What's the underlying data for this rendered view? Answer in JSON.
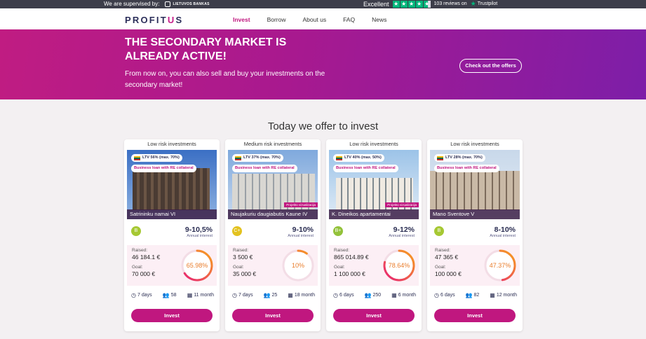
{
  "topbar": {
    "supervised": "We are supervised by:",
    "bank": "LIETUVOS BANKAS",
    "rating_word": "Excellent",
    "reviews": "103 reviews on",
    "trustpilot": "Trustpilot"
  },
  "nav": {
    "brand_a": "PROFIT",
    "brand_b": "U",
    "brand_c": "S",
    "items": [
      "Invest",
      "Borrow",
      "About us",
      "FAQ",
      "News"
    ]
  },
  "hero": {
    "title": "THE SECONDARY MARKET IS ALREADY ACTIVE!",
    "text": "From now on, you can also sell and buy your investments on the secondary market!",
    "cta": "Check out the offers"
  },
  "section_title": "Today we offer to invest",
  "labels": {
    "annual_interest": "Annual interest",
    "raised": "Raised:",
    "goal": "Goal:",
    "invest": "Invest",
    "business_loan": "Business loan with RE collateral",
    "project_vis": "Projekto vizualizacija"
  },
  "cards": [
    {
      "risk": "Low risk investments",
      "ltv": "LTV 56% (max. 70%)",
      "name": "Satrininku namai VI",
      "grade": "B",
      "grade_color": "#a6c833",
      "rate": "9-10,5%",
      "raised": "46 184.1 €",
      "goal": "70 000 €",
      "pct": "65.98%",
      "progress": 0.6598,
      "days": "7 days",
      "investors": "58",
      "term": "11 month"
    },
    {
      "risk": "Medium risk investments",
      "ltv": "LTV 37% (max. 70%)",
      "name": "Naujakuriu daugiabutis Kaune IV",
      "grade": "C+",
      "grade_color": "#e3c21f",
      "rate": "9-10%",
      "raised": "3 500 €",
      "goal": "35 000 €",
      "pct": "10%",
      "progress": 0.1,
      "days": "7 days",
      "investors": "25",
      "term": "18 month"
    },
    {
      "risk": "Low risk investments",
      "ltv": "LTV 40% (max. 50%)",
      "name": "K. Dineikos apartamentai",
      "grade": "B+",
      "grade_color": "#93c23a",
      "rate": "9-12%",
      "raised": "865 014.89 €",
      "goal": "1 100 000 €",
      "pct": "78.64%",
      "progress": 0.7864,
      "days": "6 days",
      "investors": "250",
      "term": "6 month"
    },
    {
      "risk": "Low risk investments",
      "ltv": "LTV 28% (max. 70%)",
      "name": "Mano Sventove V",
      "grade": "B",
      "grade_color": "#a6c833",
      "rate": "8-10%",
      "raised": "47 365 €",
      "goal": "100 000 €",
      "pct": "47.37%",
      "progress": 0.4737,
      "days": "6 days",
      "investors": "82",
      "term": "12 month"
    }
  ]
}
